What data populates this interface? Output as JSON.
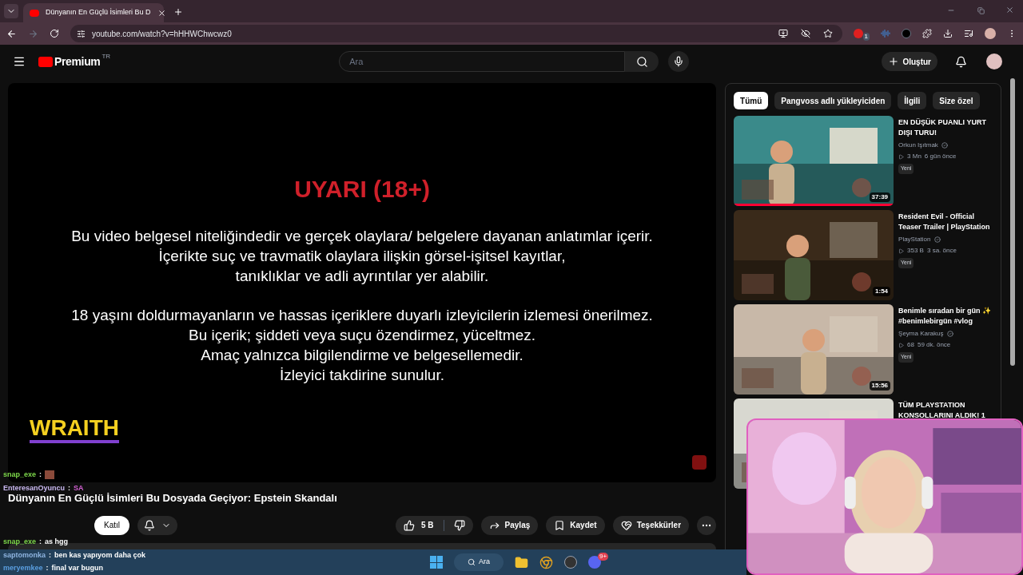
{
  "browser": {
    "tab_title": "Dünyanın En Güçlü İsimleri Bu D",
    "url": "youtube.com/watch?v=hHHWChwcwz0",
    "extension_badge": "1"
  },
  "header": {
    "logo": "Premium",
    "region": "TR",
    "search_placeholder": "Ara",
    "create_label": "Oluştur"
  },
  "player": {
    "warning_title": "UYARI (18+)",
    "paragraphs": [
      [
        "Bu video belgesel niteliğindedir ve gerçek olaylara/ belgelere dayanan anlatımlar içerir.",
        "İçerikte suç ve travmatik olaylara ilişkin görsel-işitsel kayıtlar,",
        "tanıklıklar ve adli ayrıntılar yer alabilir."
      ],
      [
        "18 yaşını doldurmayanların ve hassas içeriklere duyarlı izleyicilerin izlemesi önerilmez.",
        "Bu içerik; şiddeti veya suçu özendirmez, yüceltmez.",
        "Amaç yalnızca bilgilendirme ve belgesellemedir.",
        "İzleyici takdirine sunulur."
      ]
    ],
    "brand": "WRAITH"
  },
  "video": {
    "title": "Dünyanın En Güçlü İsimleri Bu Dosyada Geçiyor: Epstein Skandalı",
    "join_label": "Katıl",
    "likes": "5 B",
    "actions": [
      "Paylaş",
      "Kaydet",
      "Teşekkürler"
    ]
  },
  "chips": [
    {
      "label": "Tümü",
      "selected": true
    },
    {
      "label": "Pangvoss adlı yükleyiciden",
      "selected": false
    },
    {
      "label": "İlgili",
      "selected": false
    },
    {
      "label": "Size özel",
      "selected": false
    }
  ],
  "recommendations": [
    {
      "title": "EN DÜŞÜK PUANLI YURT DIŞI TURU!",
      "channel": "Orkun Işıtmak",
      "views": "3 Mn",
      "age": "6 gün önce",
      "badge": "Yeni",
      "duration": "37:39",
      "watched": true
    },
    {
      "title": "Resident Evil - Official Teaser Trailer | PlayStation",
      "channel": "PlayStation",
      "views": "353 B",
      "age": "3 sa. önce",
      "badge": "Yeni",
      "duration": "1:54",
      "watched": false
    },
    {
      "title": "Benimle sıradan bir gün ✨ #benimlebirgün #vlog",
      "channel": "Şeyma Karakuş",
      "views": "68",
      "age": "59 dk. önce",
      "badge": "Yeni",
      "duration": "15:56",
      "watched": false
    },
    {
      "title": "TÜM PLAYSTATION KONSOLLARINI ALDIK! 1 ..."
    }
  ],
  "chat": [
    {
      "user": "snap_exe",
      "separator": ":",
      "color": "#7dd84a"
    },
    {
      "user": "EnteresanOyuncu",
      "separator": ":",
      "message": "SA",
      "color": "#c9b8f0"
    },
    {
      "user": "snap_exe",
      "separator": ":",
      "message": "as hgg",
      "color": "#7dd84a"
    },
    {
      "user": "saptomonka",
      "separator": ":",
      "message": "ben kas yapıyom daha çok",
      "color": "#8fb4e0"
    },
    {
      "user": "meryemkee",
      "separator": ":",
      "message": "final var bugun",
      "color": "#5a9ee0"
    }
  ],
  "taskbar": {
    "search_label": "Ara",
    "discord_badge": "9+"
  }
}
